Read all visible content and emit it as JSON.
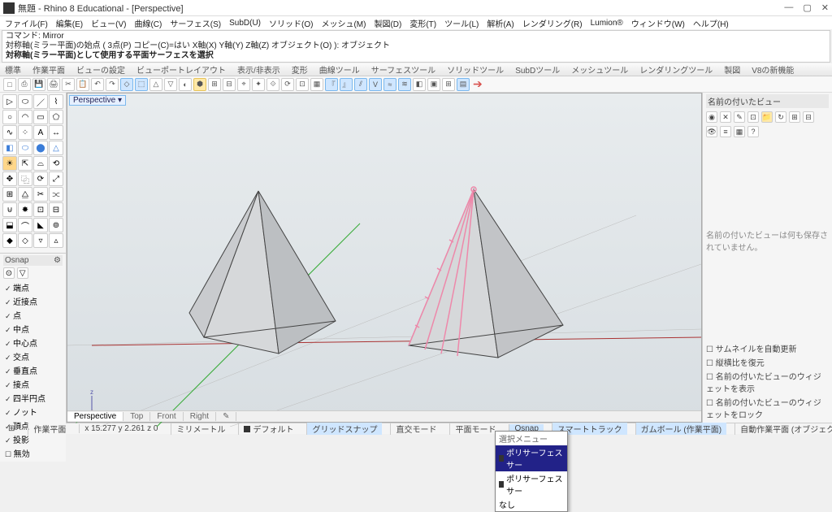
{
  "window": {
    "title": "無題 - Rhino 8 Educational - [Perspective]",
    "btn_min": "—",
    "btn_max": "▢",
    "btn_close": "✕"
  },
  "menu": [
    "ファイル(F)",
    "編集(E)",
    "ビュー(V)",
    "曲線(C)",
    "サーフェス(S)",
    "SubD(U)",
    "ソリッド(O)",
    "メッシュ(M)",
    "製図(D)",
    "変形(T)",
    "ツール(L)",
    "解析(A)",
    "レンダリング(R)",
    "Lumion®",
    "ウィンドウ(W)",
    "ヘルプ(H)"
  ],
  "command": {
    "line1": "コマンド: Mirror",
    "line2": "対称軸(ミラー平面)の始点 ( 3点(P)  コピー(C)=はい  X軸(X)  Y軸(Y)  Z軸(Z)  オブジェクト(O) ): オブジェクト",
    "line3": "対称軸(ミラー平面)として使用する平面サーフェスを選択"
  },
  "tabs": [
    "標準",
    "作業平面",
    "ビューの設定",
    "ビューポートレイアウト",
    "表示/非表示",
    "変形",
    "曲線ツール",
    "サーフェスツール",
    "ソリッドツール",
    "SubDツール",
    "メッシュツール",
    "レンダリングツール",
    "製図",
    "V8の新機能"
  ],
  "osnap": {
    "title": "Osnap",
    "items": [
      "端点",
      "近接点",
      "点",
      "中点",
      "中心点",
      "交点",
      "垂直点",
      "接点",
      "四半円点",
      "ノット",
      "頂点",
      "投影"
    ],
    "disable": "無効"
  },
  "viewport": {
    "label": "Perspective ▾",
    "tabs": [
      "Perspective",
      "Top",
      "Front",
      "Right"
    ]
  },
  "right": {
    "title": "名前の付いたビュー",
    "note": "名前の付いたビューは何も保存されていません。",
    "checks": [
      "サムネイルを自動更新",
      "縦横比を復元",
      "名前の付いたビューのウィジェットを表示",
      "名前の付いたビューのウィジェットをロック"
    ]
  },
  "context": {
    "title": "選択メニュー",
    "items": [
      "ポリサーフェス サー",
      "ポリサーフェス サー",
      "なし"
    ]
  },
  "status": {
    "cplane_icon": "⊞",
    "cplane": "作業平面",
    "coords": "x 15.277   y 2.261   z 0",
    "units": "ミリメートル",
    "layer": "デフォルト",
    "toggles": [
      "グリッドスナップ",
      "直交モード",
      "平面モード",
      "Osnap",
      "スマートトラック",
      "ガムボール (作業平面)"
    ],
    "tail": "自動作業平面 (オブジェクト)  ヒストリを記録  フィ"
  }
}
